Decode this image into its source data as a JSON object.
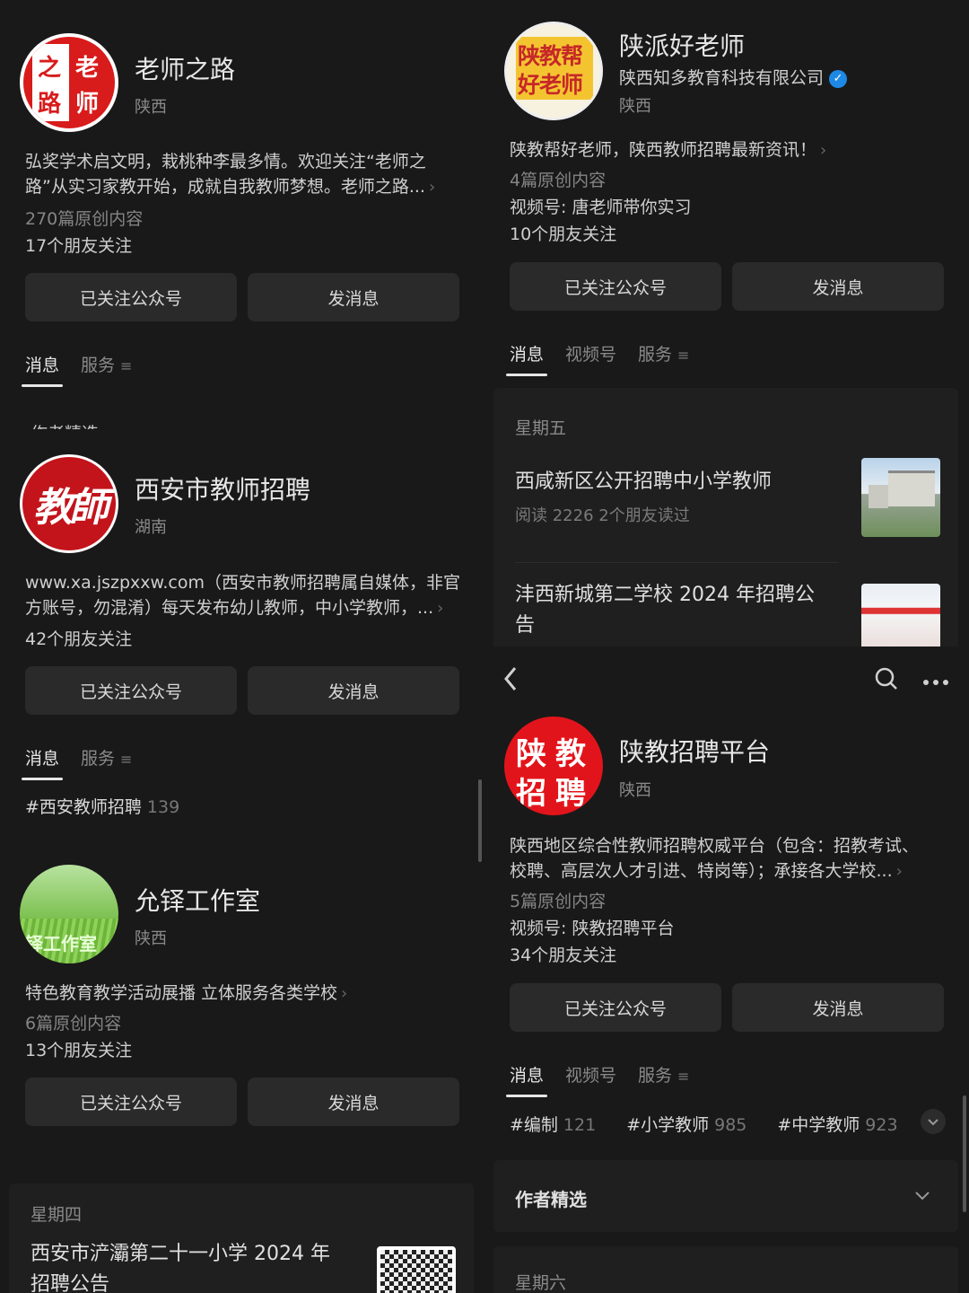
{
  "p1": {
    "name": "老师之路",
    "region": "陕西",
    "avatar_text": [
      "之",
      "老",
      "路",
      "师"
    ],
    "desc_line1": "弘奖学术启文明，栽桃种李最多情。欢迎关注“老师之",
    "desc_line2": "路”从实习家教开始，成就自我教师梦想。老师之路...",
    "articles": "270篇原创内容",
    "friends": "17个朋友关注",
    "btn_follow": "已关注公众号",
    "btn_msg": "发消息",
    "tab_msg": "消息",
    "tab_service": "服务",
    "partial_heading": "作者精选"
  },
  "p2": {
    "name": "陕派好老师",
    "company": "陕西知多教育科技有限公司",
    "region": "陕西",
    "avatar_text_top": "陕教帮",
    "avatar_text_bottom": "好老师",
    "desc": "陕教帮好老师，陕西教师招聘最新资讯！",
    "articles": "4篇原创内容",
    "video": "视频号: 唐老师带你实习",
    "friends": "10个朋友关注",
    "btn_follow": "已关注公众号",
    "btn_msg": "发消息",
    "tab_msg": "消息",
    "tab_video": "视频号",
    "tab_service": "服务",
    "day": "星期五",
    "article1_title": "西咸新区公开招聘中小学教师",
    "article1_meta": "阅读 2226  2个朋友读过",
    "article2_title_line1": "沣西新城第二学校 2024 年招聘公",
    "article2_title_line2": "告"
  },
  "p3": {
    "name": "西安市教师招聘",
    "region": "湖南",
    "avatar_text": "教師",
    "desc_line1": "www.xa.jszpxxw.com（西安市教师招聘属自媒体，非官",
    "desc_line2": "方账号，勿混淆）每天发布幼儿教师，中小学教师，...",
    "friends": "42个朋友关注",
    "btn_follow": "已关注公众号",
    "btn_msg": "发消息",
    "tab_msg": "消息",
    "tab_service": "服务",
    "tag": "#西安教师招聘",
    "tag_count": "139",
    "name2": "允铎工作室",
    "region2": "陕西",
    "avatar2_text": "铎工作室",
    "desc2": "特色教育教学活动展播  立体服务各类学校",
    "articles2": "6篇原创内容",
    "friends2": "13个朋友关注",
    "btn_follow2": "已关注公众号",
    "btn_msg2": "发消息",
    "day": "星期四",
    "article_line1": "西安市浐灞第二十一小学 2024 年",
    "article_line2": "招聘公告"
  },
  "p4": {
    "name": "陕教招聘平台",
    "region": "陕西",
    "avatar_text": [
      "陕",
      "教",
      "招",
      "聘"
    ],
    "desc_line1": "陕西地区综合性教师招聘权威平台（包含：招教考试、",
    "desc_line2": "校聘、高层次人才引进、特岗等）；承接各大学校...",
    "articles": "5篇原创内容",
    "video": "视频号: 陕教招聘平台",
    "friends": "34个朋友关注",
    "btn_follow": "已关注公众号",
    "btn_msg": "发消息",
    "tab_msg": "消息",
    "tab_video": "视频号",
    "tab_service": "服务",
    "tags": [
      {
        "label": "#编制",
        "count": "121"
      },
      {
        "label": "#小学教师",
        "count": "985"
      },
      {
        "label": "#中学教师",
        "count": "923"
      }
    ],
    "section": "作者精选",
    "day": "星期六"
  }
}
